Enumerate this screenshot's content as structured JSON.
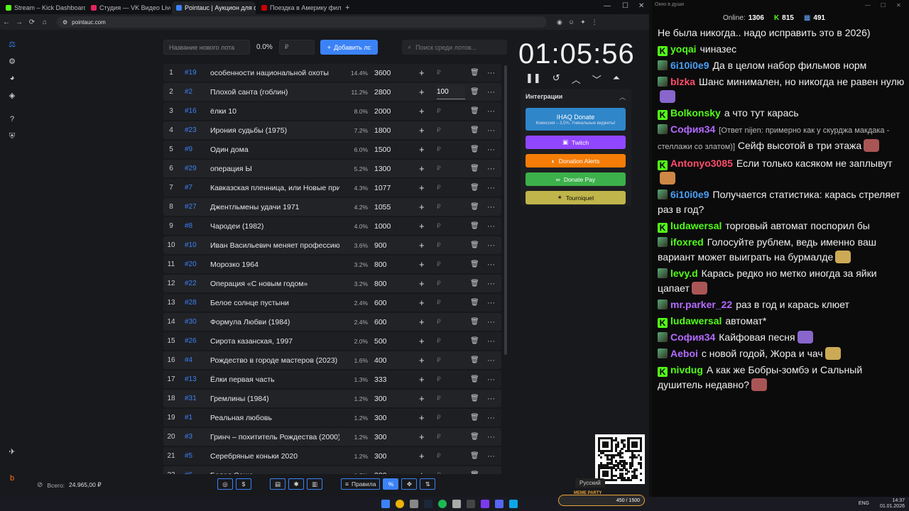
{
  "browser": {
    "tabs": [
      {
        "title": "Stream – Kick Dashboard",
        "color": "#53fc18",
        "active": false
      },
      {
        "title": "Студия — VK Видео Live",
        "color": "#e0245e",
        "active": false
      },
      {
        "title": "Pointauc | Аукцион для стрим…",
        "color": "#3b82f6",
        "active": true
      },
      {
        "title": "Поездка в Америку фильм, 19…",
        "color": "#cc0000",
        "active": false
      }
    ],
    "url": "pointauc.com"
  },
  "toolbar": {
    "new_lot_placeholder": "Название нового лота",
    "percent": "0.0%",
    "amount_placeholder": "₽",
    "add_label": "Добавить лс",
    "search_placeholder": "Поиск среди лотов..."
  },
  "lots": [
    {
      "n": "1",
      "id": "#19",
      "name": "особенности национальной охоты",
      "pct": "14.4%",
      "amount": "3600",
      "input": "₽",
      "progress": 0.144
    },
    {
      "n": "2",
      "id": "#2",
      "name": "Плохой санта (гоблин)",
      "pct": "11.2%",
      "amount": "2800",
      "input": "100",
      "progress": 0.112
    },
    {
      "n": "3",
      "id": "#16",
      "name": "ёлки 10",
      "pct": "8.0%",
      "amount": "2000",
      "input": "₽",
      "progress": 0.08
    },
    {
      "n": "4",
      "id": "#23",
      "name": "Ирония судьбы (1975)",
      "pct": "7.2%",
      "amount": "1800",
      "input": "₽",
      "progress": 0.072
    },
    {
      "n": "5",
      "id": "#9",
      "name": "Один дома",
      "pct": "6.0%",
      "amount": "1500",
      "input": "₽",
      "progress": 0.06
    },
    {
      "n": "6",
      "id": "#29",
      "name": "операция Ы",
      "pct": "5.2%",
      "amount": "1300",
      "input": "₽",
      "progress": 0.052
    },
    {
      "n": "7",
      "id": "#7",
      "name": "Кавказская пленница, или Новые при",
      "pct": "4.3%",
      "amount": "1077",
      "input": "₽",
      "progress": 0.043
    },
    {
      "n": "8",
      "id": "#27",
      "name": "Джентльмены удачи 1971",
      "pct": "4.2%",
      "amount": "1055",
      "input": "₽",
      "progress": 0.042
    },
    {
      "n": "9",
      "id": "#8",
      "name": "Чародеи (1982)",
      "pct": "4.0%",
      "amount": "1000",
      "input": "₽",
      "progress": 0.04
    },
    {
      "n": "10",
      "id": "#10",
      "name": "Иван Васильевич меняет профессию",
      "pct": "3.6%",
      "amount": "900",
      "input": "₽",
      "progress": 0.036
    },
    {
      "n": "11",
      "id": "#20",
      "name": "Морозко 1964",
      "pct": "3.2%",
      "amount": "800",
      "input": "₽",
      "progress": 0.032
    },
    {
      "n": "12",
      "id": "#22",
      "name": "Операция «С новым годом»",
      "pct": "3.2%",
      "amount": "800",
      "input": "₽",
      "progress": 0.032
    },
    {
      "n": "13",
      "id": "#28",
      "name": "Белое солнце пустыни",
      "pct": "2.4%",
      "amount": "600",
      "input": "₽",
      "progress": 0.024
    },
    {
      "n": "14",
      "id": "#30",
      "name": "Формула Любви (1984)",
      "pct": "2.4%",
      "amount": "600",
      "input": "₽",
      "progress": 0.024
    },
    {
      "n": "15",
      "id": "#26",
      "name": "Сирота казанская, 1997",
      "pct": "2.0%",
      "amount": "500",
      "input": "₽",
      "progress": 0.02
    },
    {
      "n": "16",
      "id": "#4",
      "name": "Рождество в городе мастеров (2023)",
      "pct": "1.6%",
      "amount": "400",
      "input": "₽",
      "progress": 0.016
    },
    {
      "n": "17",
      "id": "#13",
      "name": "Ёлки первая часть",
      "pct": "1.3%",
      "amount": "333",
      "input": "₽",
      "progress": 0.013
    },
    {
      "n": "18",
      "id": "#31",
      "name": "Гремлины (1984)",
      "pct": "1.2%",
      "amount": "300",
      "input": "₽",
      "progress": 0.012
    },
    {
      "n": "19",
      "id": "#1",
      "name": "Реальная любовь",
      "pct": "1.2%",
      "amount": "300",
      "input": "₽",
      "progress": 0.012
    },
    {
      "n": "20",
      "id": "#3",
      "name": "Гринч – похититель Рождества (2000)",
      "pct": "1.2%",
      "amount": "300",
      "input": "₽",
      "progress": 0.012
    },
    {
      "n": "21",
      "id": "#5",
      "name": "Серебряные коньки 2020",
      "pct": "1.2%",
      "amount": "300",
      "input": "₽",
      "progress": 0.012
    },
    {
      "n": "22",
      "id": "#6",
      "name": "Белая Саша",
      "pct": "1.2%",
      "amount": "300",
      "input": "₽",
      "progress": 0.012
    }
  ],
  "timer": "01:05:56",
  "integrations": {
    "title": "Интеграции",
    "buttons": [
      {
        "label": "IHAQ Donate",
        "sub": "Комиссия – 3,5%. Уникальные виджеты!",
        "color": "#2f86c9"
      },
      {
        "label": "Twitch",
        "color": "#9146ff"
      },
      {
        "label": "Donation Alerts",
        "color": "#f57d07"
      },
      {
        "label": "Donate Pay",
        "color": "#3cb04a"
      },
      {
        "label": "Tourniquet",
        "color": "#bfb54a"
      }
    ]
  },
  "footer": {
    "total_label": "Всего:",
    "total_value": "24.965,00 ₽",
    "rules_label": "Правила",
    "percent_symbol": "%",
    "language": "Русский"
  },
  "chat": {
    "window_title": "Окно в души",
    "online_label": "Online:",
    "online_value": "1306",
    "kick_count": "815",
    "other_count": "491",
    "messages": [
      {
        "user": "",
        "color": "#fff",
        "badge": "none",
        "text": "Не была никогда.. надо исправить это в 2026)"
      },
      {
        "user": "yoqai",
        "color": "#53fc18",
        "badge": "kick",
        "text": "чиназес"
      },
      {
        "user": "6i10i0e9",
        "color": "#4a9ff5",
        "badge": "av",
        "text": "Да в целом набор фильмов норм"
      },
      {
        "user": "blzka",
        "color": "#ff4d6a",
        "badge": "av",
        "text": "Шанс минимален, но никогда не равен нулю"
      },
      {
        "user": "Bolkonsky",
        "color": "#53fc18",
        "badge": "kick",
        "text": "а что тут карась"
      },
      {
        "user": "София34",
        "color": "#b36bff",
        "badge": "av",
        "reply": "[Ответ nijen: примерно как у скурджа макдака - стеллажи со златом)]",
        "text": "Сейф высотой в три этажа"
      },
      {
        "user": "Antonyo3085",
        "color": "#ff4d6a",
        "badge": "kick",
        "text": "Если только касяком не заплывут"
      },
      {
        "user": "6i10i0e9",
        "color": "#4a9ff5",
        "badge": "av",
        "text": "Получается статистика: карась стреляет раз в год?"
      },
      {
        "user": "ludawersal",
        "color": "#53fc18",
        "badge": "kick",
        "text": "торговый автомат поспорил бы"
      },
      {
        "user": "ifoxred",
        "color": "#53fc18",
        "badge": "av",
        "text": "Голосуйте рублем, ведь именно ваш вариант может выиграть на бурмалде"
      },
      {
        "user": "levy.d",
        "color": "#53fc18",
        "badge": "av",
        "text": "Карась редко но метко иногда за яйки цапает"
      },
      {
        "user": "mr.parker_22",
        "color": "#b36bff",
        "badge": "av",
        "text": "раз в год и карась клюет"
      },
      {
        "user": "ludawersal",
        "color": "#53fc18",
        "badge": "kick",
        "text": "автомат*"
      },
      {
        "user": "София34",
        "color": "#b36bff",
        "badge": "av",
        "text": "Кайфовая песня"
      },
      {
        "user": "Aeboi",
        "color": "#b36bff",
        "badge": "av",
        "text": "с новой годой, Жора и чач"
      },
      {
        "user": "nivdug",
        "color": "#53fc18",
        "badge": "kick",
        "text": "А как же Бобры-зомбэ и Сальный душитель недавно?"
      }
    ]
  },
  "taskbar": {
    "lang": "ENG",
    "time": "14:37",
    "date": "01.01.2026",
    "meme_party_label": "MEME PARTY",
    "meme_party_value": "450 / 1500"
  }
}
